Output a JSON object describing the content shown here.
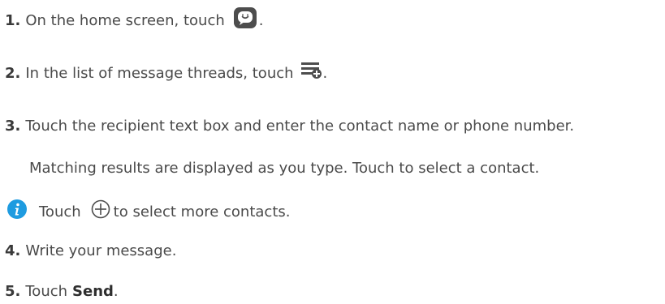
{
  "steps": [
    {
      "num": "1.",
      "text": "On the home screen, touch",
      "after": "."
    },
    {
      "num": "2.",
      "text": "In the list of message threads, touch",
      "after": "."
    },
    {
      "num": "3.",
      "text": "Touch the recipient text box and enter the contact name or phone number.",
      "cont": "Matching results are displayed as you type. Touch to select a contact."
    },
    {
      "num": "4.",
      "text": "Write your message."
    },
    {
      "num": "5.",
      "text": "Touch",
      "bold": "Send",
      "after": "."
    }
  ],
  "note": {
    "before": "Touch",
    "after": "to select more contacts."
  },
  "icons": {
    "step1": "messaging-app-icon",
    "step2": "new-message-icon",
    "note": "info-icon",
    "note_inline": "add-circle-icon"
  },
  "colors": {
    "info": "#1e9be0",
    "text": "#4a4a4a",
    "icon_dark": "#4d4d4d"
  }
}
